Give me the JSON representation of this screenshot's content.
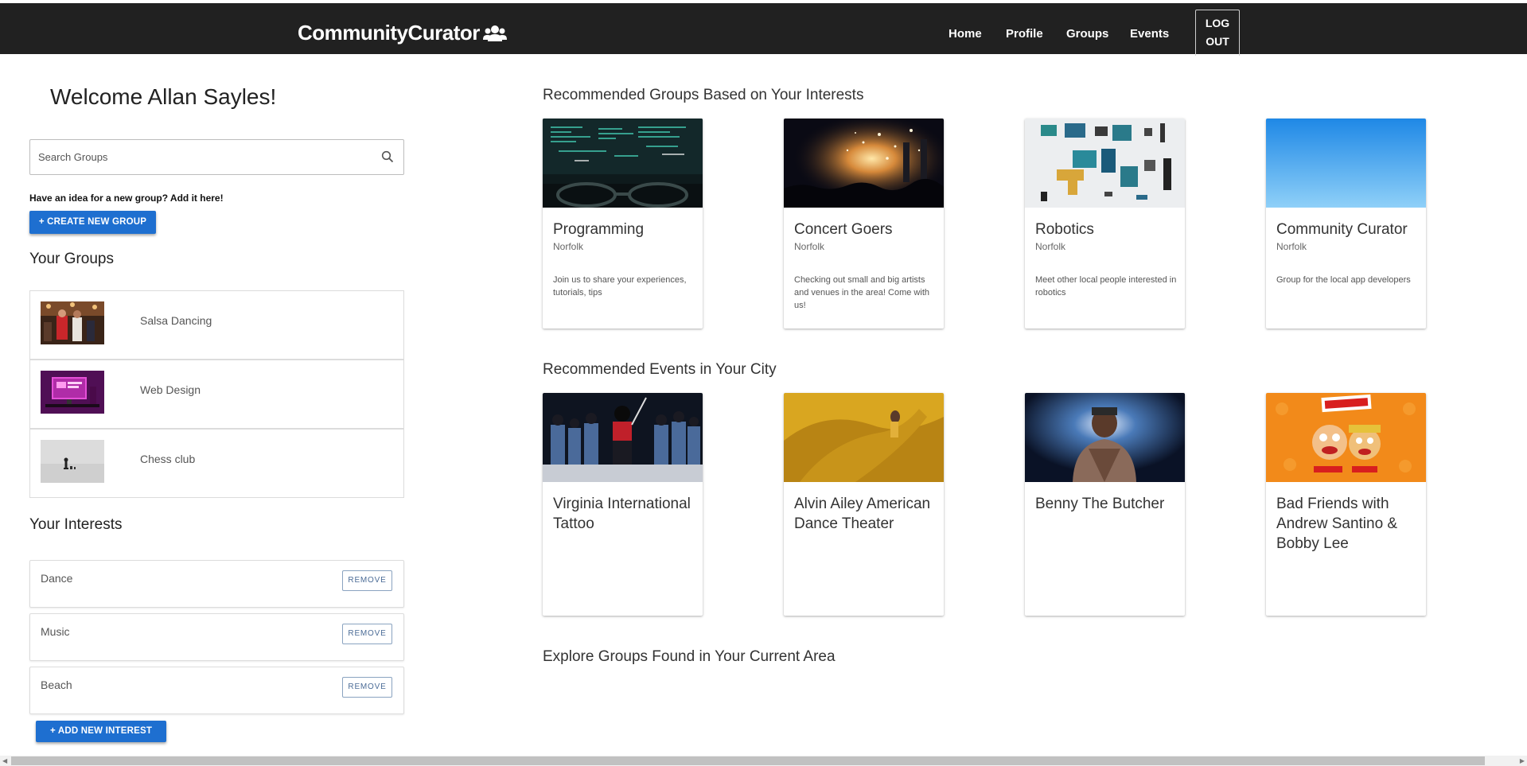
{
  "navbar": {
    "brand": "CommunityCurator",
    "brand_icon": "users-icon",
    "links": [
      "Home",
      "Profile",
      "Groups",
      "Events"
    ],
    "logout_line1": "LOG",
    "logout_line2": "OUT"
  },
  "sidebar": {
    "welcome": "Welcome Allan Sayles!",
    "search_placeholder": "Search Groups",
    "idea_text": "Have an idea for a new group? Add it here!",
    "create_button": "+ CREATE NEW GROUP",
    "your_groups_heading": "Your Groups",
    "groups": [
      {
        "name": "Salsa Dancing",
        "image": "salsa-dancing-photo"
      },
      {
        "name": "Web Design",
        "image": "web-design-photo"
      },
      {
        "name": "Chess club",
        "image": "chess-photo"
      }
    ],
    "your_interests_heading": "Your Interests",
    "interests": [
      {
        "name": "Dance",
        "remove_label": "REMOVE"
      },
      {
        "name": "Music",
        "remove_label": "REMOVE"
      },
      {
        "name": "Beach",
        "remove_label": "REMOVE"
      }
    ],
    "add_interest_button": "+ ADD NEW INTEREST"
  },
  "main": {
    "recommended_groups_heading": "Recommended Groups Based on Your Interests",
    "recommended_groups": [
      {
        "title": "Programming",
        "city": "Norfolk",
        "description": "Join us to share your experiences, tutorials, tips"
      },
      {
        "title": "Concert Goers",
        "city": "Norfolk",
        "description": "Checking out small and big artists and venues in the area! Come with us!"
      },
      {
        "title": "Robotics",
        "city": "Norfolk",
        "description": "Meet other local people interested in robotics"
      },
      {
        "title": "Community Curator",
        "city": "Norfolk",
        "description": "Group for the local app developers"
      }
    ],
    "recommended_events_heading": "Recommended Events in Your City",
    "recommended_events": [
      {
        "title": "Virginia International Tattoo"
      },
      {
        "title": "Alvin Ailey American Dance Theater"
      },
      {
        "title": "Benny The Butcher"
      },
      {
        "title": "Bad Friends with Andrew Santino & Bobby Lee"
      }
    ],
    "explore_heading": "Explore Groups Found in Your Current Area"
  },
  "colors": {
    "navbar_bg": "#212121",
    "primary_button": "#1e6fd0",
    "remove_border": "#8aa3c0"
  }
}
